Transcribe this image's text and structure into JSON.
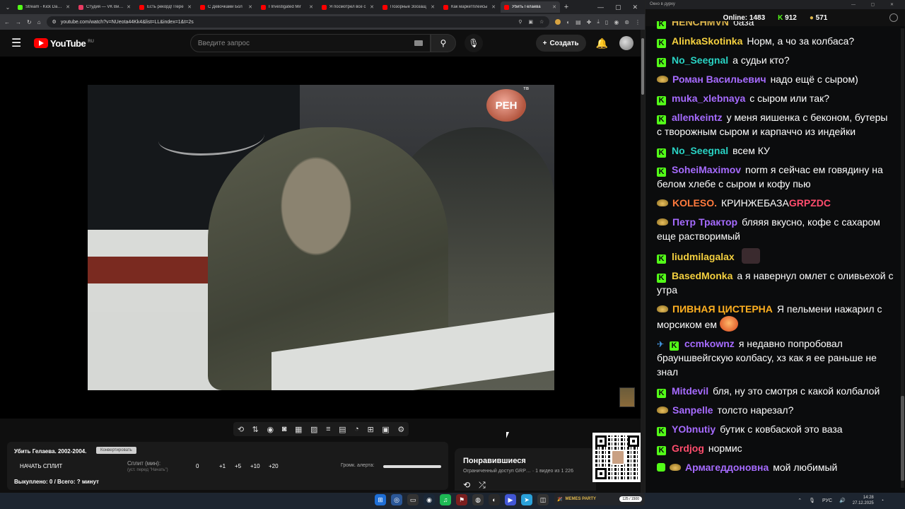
{
  "browser": {
    "tabs": [
      {
        "title": "Stream - Kick Dashb",
        "color": "#53fc18"
      },
      {
        "title": "Студия — VK Видео",
        "color": "#e83b62"
      },
      {
        "title": "Есть рекорд! Пере",
        "color": "#ff0000"
      },
      {
        "title": "С Девочками Бол",
        "color": "#ff0000"
      },
      {
        "title": "I Investigated Mir",
        "color": "#ff0000"
      },
      {
        "title": "Я посмотрел все с",
        "color": "#ff0000"
      },
      {
        "title": "Позорные Зоозащ",
        "color": "#ff0000"
      },
      {
        "title": "Как маркетплейсы",
        "color": "#ff0000"
      },
      {
        "title": "Убить Гелаева",
        "color": "#ff0000"
      }
    ],
    "url": "youtube.com/watch?v=NUeota44Kk4&list=LL&index=1&t=2s"
  },
  "youtube": {
    "logo_text": "YouTube",
    "region": "RU",
    "search_placeholder": "Введите запрос",
    "create_label": "Создать",
    "watermark": "РЕН",
    "watermark_tv": "тв"
  },
  "split_panel": {
    "title": "Убить Гелаева. 2002-2004.",
    "badge": "Конвертировать",
    "start_label": "НАЧАТЬ СПЛИТ",
    "split_label": "Сплит (мин):",
    "split_hint": "(уст. перед \"Начать\")",
    "value": "0",
    "steps": [
      "+1",
      "+5",
      "+10",
      "+20"
    ],
    "alert_label": "Громк. алерта:",
    "stats": "Выкуплено: 0 / Всего: ? минут"
  },
  "liked": {
    "title": "Понравившиеся",
    "meta": "Ограниченный доступ  GRP…  · 1 видео из 1 226"
  },
  "chat": {
    "window_title": "Окно в дурку",
    "online": "Online: 1483",
    "kicks": "912",
    "coins": "571",
    "colors": {
      "kick": "#53fc18",
      "gold": "#e0b84c"
    },
    "messages": [
      {
        "badges": [
          "k"
        ],
        "nick": "HENCHMVN",
        "color": "#e0b84c",
        "text": "база",
        "clipped": true
      },
      {
        "badges": [
          "k"
        ],
        "nick": "AlinkaSkotinka",
        "color": "#f4d03f",
        "text": "Норм, а чо за колбаса?"
      },
      {
        "badges": [
          "k"
        ],
        "nick": "No_Seegnal",
        "color": "#29d3c4",
        "text": "а судьи кто?"
      },
      {
        "badges": [
          "g"
        ],
        "nick": "Роман Васильевич",
        "color": "#a66bff",
        "text": "надо ещё с сыром)"
      },
      {
        "badges": [
          "k"
        ],
        "nick": "muka_xlebnaya",
        "color": "#a66bff",
        "text": "с сыром или так?"
      },
      {
        "badges": [
          "k"
        ],
        "nick": "allenkeintz",
        "color": "#a66bff",
        "text": "у меня яишенка с беконом, бутеры с творожным сыром и карпаччо из индейки"
      },
      {
        "badges": [
          "k"
        ],
        "nick": "No_Seegnal",
        "color": "#29d3c4",
        "text": "всем КУ"
      },
      {
        "badges": [
          "k"
        ],
        "nick": "SoheiMaximov",
        "color": "#a66bff",
        "text": "norm я сейчас ем говядину на белом хлебе с сыром и кофу пью"
      },
      {
        "badges": [
          "g"
        ],
        "nick": "KOLESO.",
        "color": "#ff7a3d",
        "text": "КРИНЖЕБАЗА",
        "tag": "GRPZDC"
      },
      {
        "badges": [
          "g"
        ],
        "nick": "Петр Трактор",
        "color": "#a66bff",
        "text": "бляяя вкусно, кофе с сахаром еще растворимый"
      },
      {
        "badges": [
          "k"
        ],
        "nick": "liudmilagalax",
        "color": "#f4d03f",
        "text": "",
        "emote": true
      },
      {
        "badges": [
          "k"
        ],
        "nick": "BasedMonka",
        "color": "#f4d03f",
        "text": "а я навернул омлет с оливьехой с утра"
      },
      {
        "badges": [
          "g"
        ],
        "nick": "ПИВНАЯ ЦИСТЕРНА",
        "color": "#ffb020",
        "text": "Я пельмени нажарил с морсиком ем",
        "emoteFace": true
      },
      {
        "badges": [
          "p",
          "k"
        ],
        "nick": "ccmkownz",
        "color": "#a66bff",
        "text": "я недавно попробовал брауншвейгскую колбасу, хз как я ее раньше не знал"
      },
      {
        "badges": [
          "k"
        ],
        "nick": "Mitdevil",
        "color": "#a66bff",
        "text": "бля, ну это смотря с какой колбалой"
      },
      {
        "badges": [
          "g"
        ],
        "nick": "Sanpelle",
        "color": "#a66bff",
        "text": "толсто нарезал?"
      },
      {
        "badges": [
          "k"
        ],
        "nick": "YObnutiy",
        "color": "#a66bff",
        "text": "бутик с ковбаской это ваза"
      },
      {
        "badges": [
          "k"
        ],
        "nick": "Grdjog",
        "color": "#ff4d6d",
        "text": "нормис"
      },
      {
        "badges": [
          "s",
          "g"
        ],
        "nick": "Армагеддоновна",
        "color": "#a66bff",
        "text": "мой любимый"
      }
    ]
  },
  "taskbar": {
    "memes_label": "MEMES PARTY",
    "memes_progress": "125 / 1500",
    "lang": "РУС",
    "time": "14:28",
    "date": "27.12.2025"
  }
}
